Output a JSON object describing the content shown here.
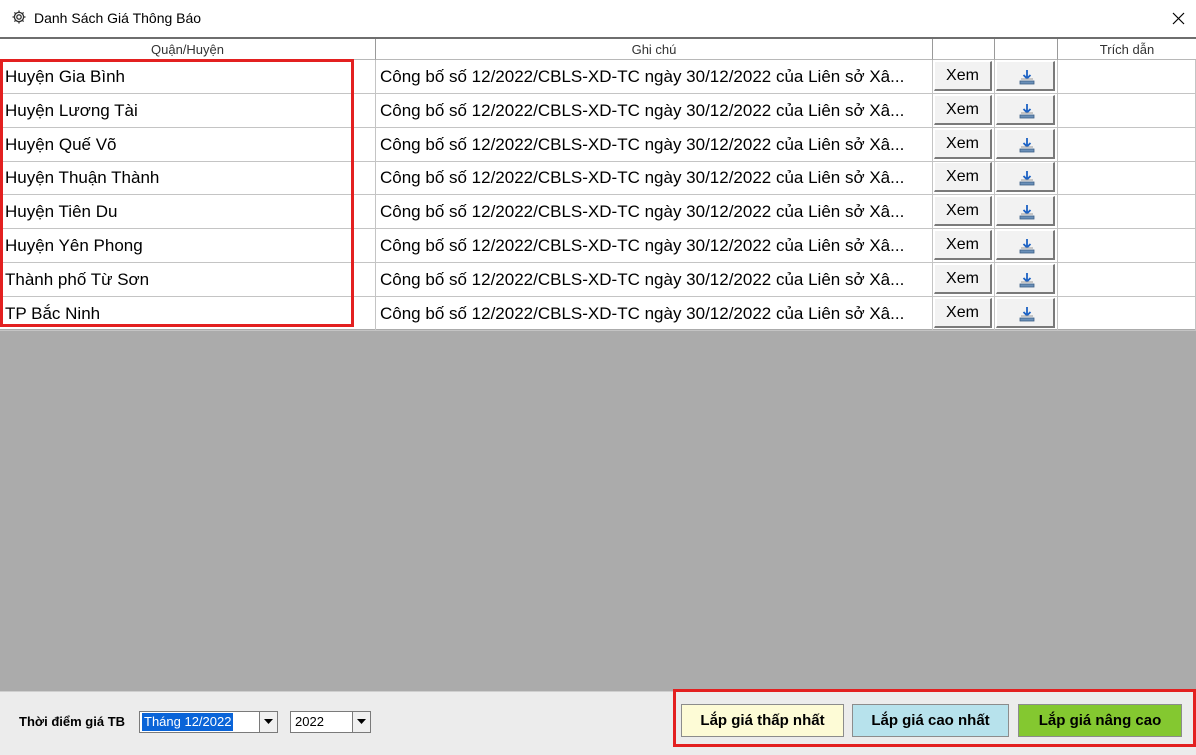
{
  "window": {
    "title": "Danh Sách Giá Thông Báo",
    "title_icon": "gear-icon",
    "close_icon": "close-icon"
  },
  "table": {
    "headers": {
      "district": "Quận/Huyện",
      "note": "Ghi chú",
      "view": "",
      "download": "",
      "citation": "Trích dẫn"
    },
    "rows": [
      {
        "district": "Huyện Gia Bình",
        "note": "Công bố số 12/2022/CBLS-XD-TC ngày 30/12/2022 của Liên sở Xâ...",
        "view": "Xem",
        "download_icon": "download-icon",
        "citation": ""
      },
      {
        "district": "Huyện Lương Tài",
        "note": "Công bố số 12/2022/CBLS-XD-TC ngày 30/12/2022 của Liên sở Xâ...",
        "view": "Xem",
        "download_icon": "download-icon",
        "citation": ""
      },
      {
        "district": "Huyện Quế Võ",
        "note": "Công bố số 12/2022/CBLS-XD-TC ngày 30/12/2022 của Liên sở Xâ...",
        "view": "Xem",
        "download_icon": "download-icon",
        "citation": ""
      },
      {
        "district": "Huyện Thuận Thành",
        "note": "Công bố số 12/2022/CBLS-XD-TC ngày 30/12/2022 của Liên sở Xâ...",
        "view": "Xem",
        "download_icon": "download-icon",
        "citation": ""
      },
      {
        "district": "Huyện Tiên Du",
        "note": "Công bố số 12/2022/CBLS-XD-TC ngày 30/12/2022 của Liên sở Xâ...",
        "view": "Xem",
        "download_icon": "download-icon",
        "citation": ""
      },
      {
        "district": "Huyện Yên Phong",
        "note": "Công bố số 12/2022/CBLS-XD-TC ngày 30/12/2022 của Liên sở Xâ...",
        "view": "Xem",
        "download_icon": "download-icon",
        "citation": ""
      },
      {
        "district": "Thành phố Từ Sơn",
        "note": "Công bố số 12/2022/CBLS-XD-TC ngày 30/12/2022 của Liên sở Xâ...",
        "view": "Xem",
        "download_icon": "download-icon",
        "citation": ""
      },
      {
        "district": "TP Bắc Ninh",
        "note": "Công bố số 12/2022/CBLS-XD-TC ngày 30/12/2022 của Liên sở Xâ...",
        "view": "Xem",
        "download_icon": "download-icon",
        "citation": ""
      }
    ]
  },
  "footer": {
    "time_label": "Thời điểm giá TB",
    "month_value": "Tháng 12/2022",
    "year_value": "2022",
    "buttons": {
      "lowest": "Lắp giá thấp nhất",
      "highest": "Lắp giá cao nhất",
      "advanced": "Lắp giá nâng cao"
    }
  },
  "colors": {
    "highlight_border": "#e32020",
    "lowest_button_bg": "#fdfbd6",
    "highest_button_bg": "#b7e2ec",
    "advanced_button_bg": "#84c830",
    "empty_area_bg": "#ababab",
    "selection_bg": "#0a64d8"
  }
}
